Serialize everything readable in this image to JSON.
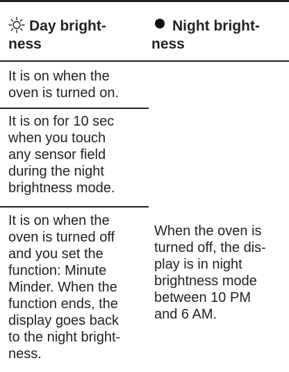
{
  "header": {
    "day_line1": "Day bright-",
    "day_line2": "ness",
    "day_icon": "sun-icon",
    "night_line1": "Night bright-",
    "night_line2": "ness",
    "night_icon": "filled-dot-icon"
  },
  "day_rows": [
    {
      "lines": [
        "It is on when the",
        "oven is turned on."
      ]
    },
    {
      "lines": [
        "It is on for 10 sec",
        "when you touch",
        "any sensor field",
        "during the night",
        "brightness mode."
      ]
    },
    {
      "lines": [
        "It is on when the",
        "oven is turned off",
        "and you set the",
        "function: Minute",
        "Minder. When the",
        "function ends, the",
        "display goes back",
        "to the night bright-",
        "ness."
      ]
    }
  ],
  "night_cell": {
    "lines": [
      "When the oven is",
      "turned off, the dis-",
      "play is in night",
      "brightness mode",
      "between 10 PM",
      "and 6 AM."
    ]
  }
}
